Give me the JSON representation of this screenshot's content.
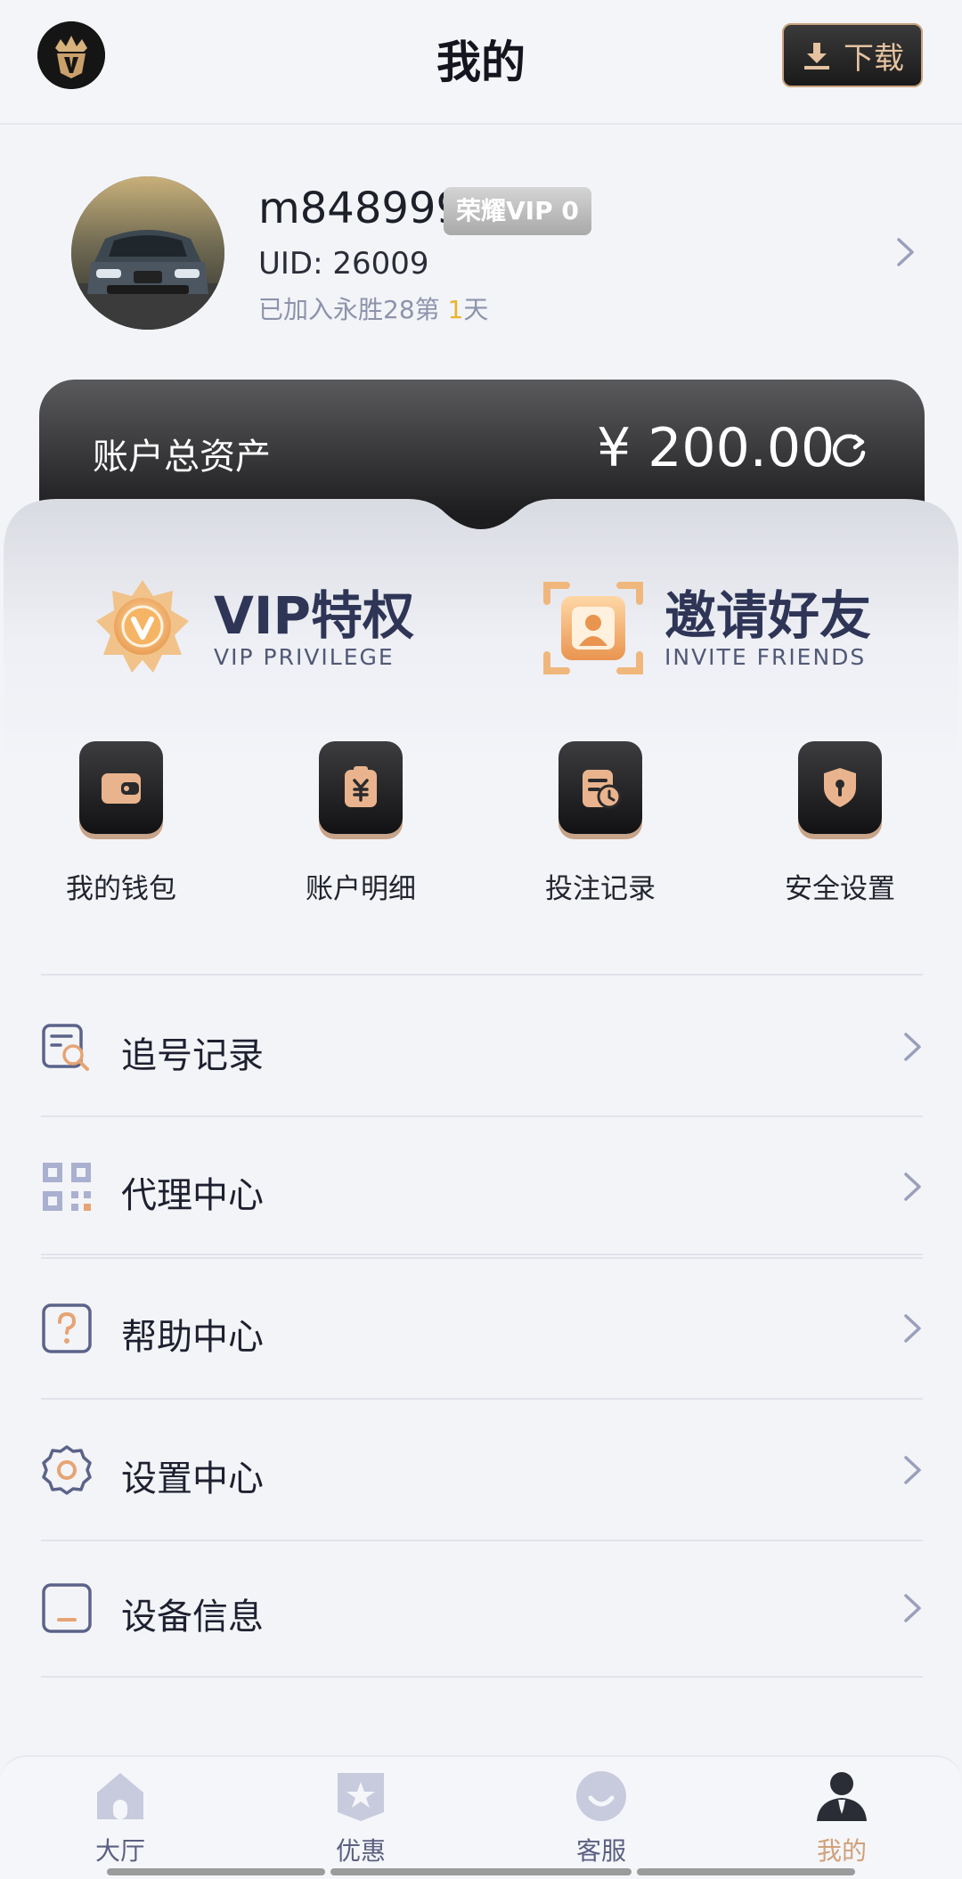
{
  "header": {
    "title": "我的",
    "download_label": "下载"
  },
  "profile": {
    "username": "m848999",
    "vip_badge": "荣耀VIP 0",
    "uid": "UID: 26009",
    "joined_prefix": "已加入永胜28第 ",
    "joined_days": "1",
    "joined_suffix": "天"
  },
  "assets": {
    "label": "账户总资产",
    "value": "¥ 200.00"
  },
  "features": [
    {
      "title": "VIP特权",
      "subtitle": "VIP PRIVILEGE",
      "icon": "vip-medal-icon"
    },
    {
      "title": "邀请好友",
      "subtitle": "INVITE FRIENDS",
      "icon": "invite-friend-icon"
    }
  ],
  "quick_actions": [
    {
      "label": "我的钱包",
      "icon": "wallet-icon"
    },
    {
      "label": "账户明细",
      "icon": "account-detail-icon"
    },
    {
      "label": "投注记录",
      "icon": "bet-record-icon"
    },
    {
      "label": "安全设置",
      "icon": "security-shield-icon"
    }
  ],
  "menu": [
    {
      "label": "追号记录",
      "icon": "tracking-record-icon"
    },
    {
      "label": "代理中心",
      "icon": "qr-code-icon"
    },
    {
      "label": "帮助中心",
      "icon": "help-icon"
    },
    {
      "label": "设置中心",
      "icon": "settings-gear-icon"
    },
    {
      "label": "设备信息",
      "icon": "device-icon"
    }
  ],
  "tabs": [
    {
      "label": "大厅",
      "icon": "home-icon",
      "active": false
    },
    {
      "label": "优惠",
      "icon": "promo-star-icon",
      "active": false
    },
    {
      "label": "客服",
      "icon": "support-icon",
      "active": false
    },
    {
      "label": "我的",
      "icon": "user-icon",
      "active": true
    }
  ],
  "colors": {
    "accent_gold": "#d0a17a",
    "navy_text": "#2e3556",
    "days_highlight": "#e8b42d"
  }
}
